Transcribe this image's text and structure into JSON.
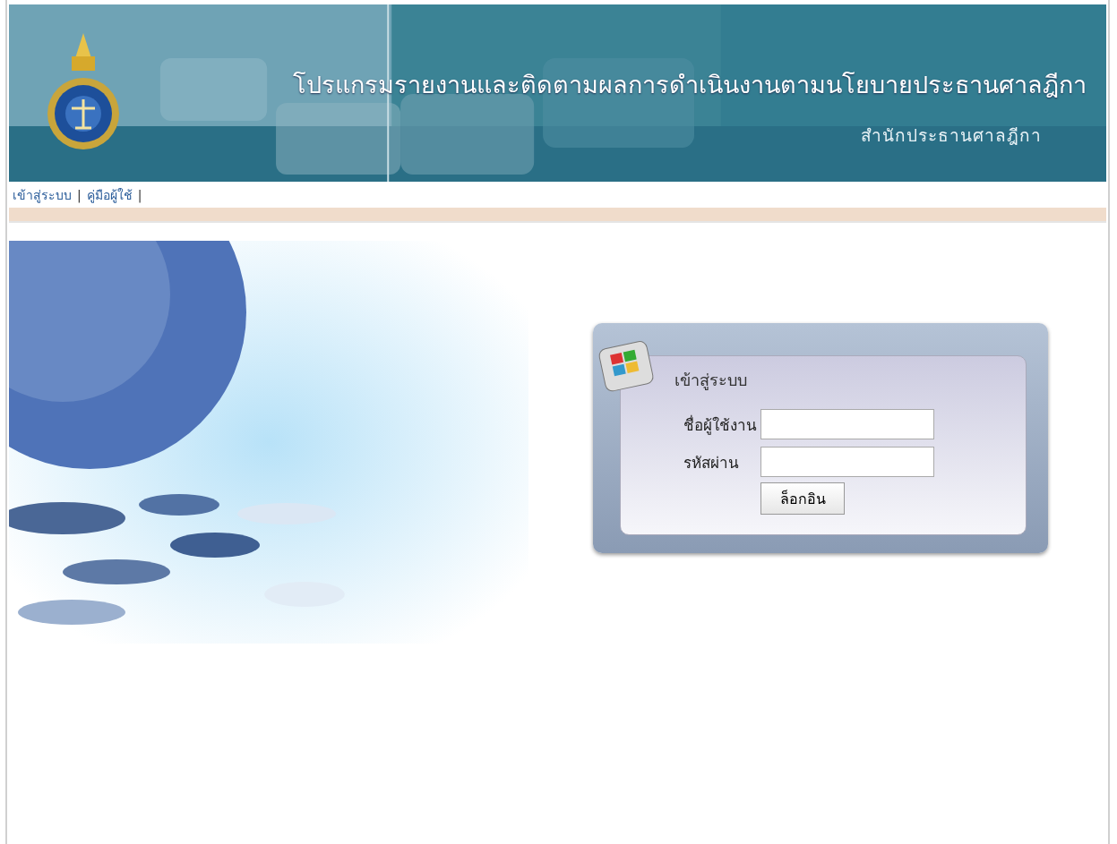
{
  "header": {
    "title": "โปรแกรมรายงานและติดตามผลการดำเนินงานตามนโยบายประธานศาลฎีกา",
    "subtitle": "สำนักประธานศาลฎีกา"
  },
  "nav": [
    {
      "label": "เข้าสู่ระบบ",
      "separator": "|"
    },
    {
      "label": "คู่มือผู้ใช้",
      "separator": "|"
    }
  ],
  "login": {
    "title": "เข้าสู่ระบบ",
    "fields": [
      {
        "label": "ชื่อผู้ใช้งาน"
      },
      {
        "label": "รหัสผ่าน"
      }
    ],
    "button": "ล็อกอิน"
  }
}
